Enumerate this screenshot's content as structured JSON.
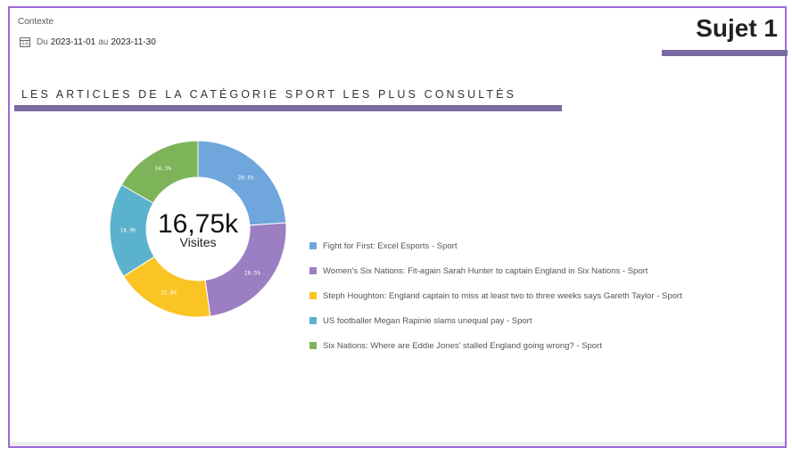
{
  "header": {
    "context_label": "Contexte",
    "date_prefix": "Du",
    "date_from": "2023-11-01",
    "date_mid": "au",
    "date_to": "2023-11-30",
    "subject": "Sujet 1"
  },
  "section": {
    "title": "Les articles de la catégorie Sport les plus consultés"
  },
  "chart_data": {
    "type": "pie",
    "center_value": "16,75k",
    "center_label": "Visites",
    "slices": [
      {
        "label": "Fight for First: Excel Esports - Sport",
        "value": 20.5,
        "display": "20.5%",
        "color": "#6fa6dc"
      },
      {
        "label": "Women's Six Nations: Fit-again Sarah Hunter to captain England in Six Nations - Sport",
        "value": 20.5,
        "display": "20.5%",
        "color": "#9b7fc2"
      },
      {
        "label": "Steph Houghton: England captain to miss at least two to three weeks says Gareth Taylor - Sport",
        "value": 15.6,
        "display": "15.6%",
        "color": "#fbc425"
      },
      {
        "label": "US footballer Megan Rapinie slams unequal pay - Sport",
        "value": 14.9,
        "display": "14.9%",
        "color": "#5bb2cc"
      },
      {
        "label": "Six Nations: Where are Eddie Jones' stalled England going wrong? - Sport",
        "value": 14.3,
        "display": "14.3%",
        "color": "#7db45a"
      }
    ],
    "legend_position": "right"
  },
  "colors": {
    "frame_border": "#9b6bd6",
    "accent_bar": "#7a6aa1"
  },
  "icons": {
    "date": "calendar-icon"
  }
}
